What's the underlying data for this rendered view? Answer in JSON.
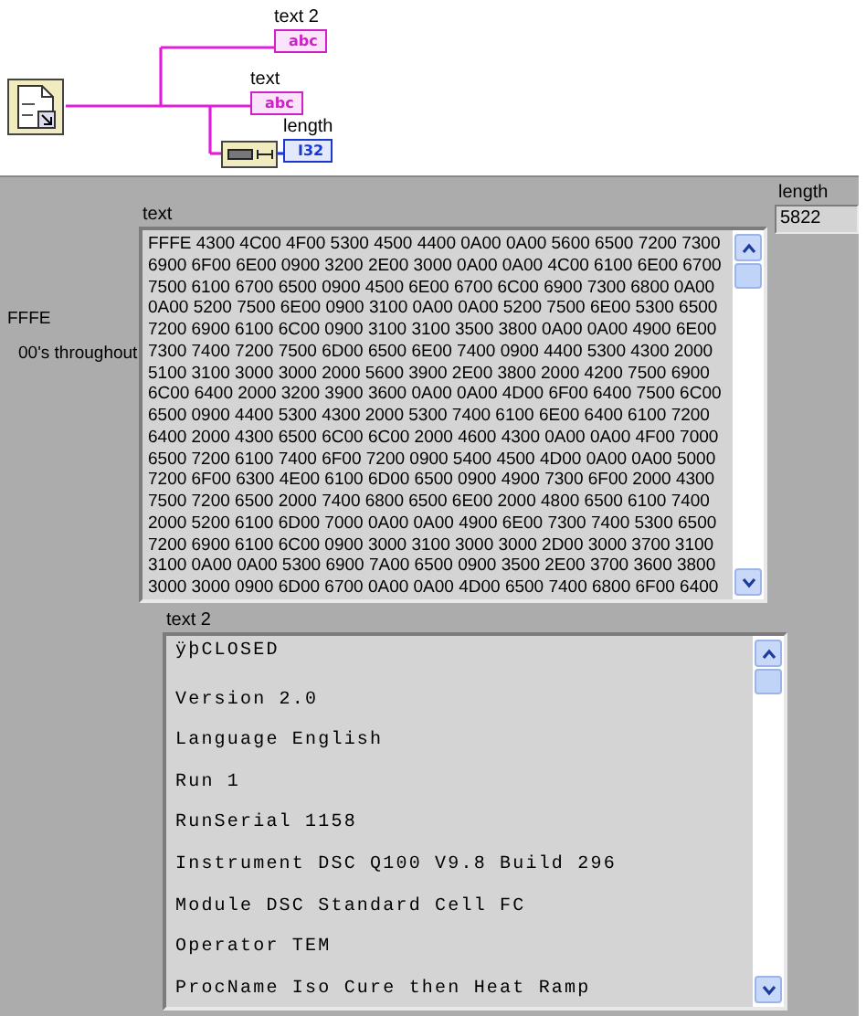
{
  "diagram": {
    "terminals": [
      {
        "label": "text 2",
        "type": "abc",
        "kind": "string"
      },
      {
        "label": "text",
        "type": "abc",
        "kind": "string"
      },
      {
        "label": "length",
        "type": "I32",
        "kind": "numeric"
      }
    ]
  },
  "panel": {
    "notes": [
      "FFFE",
      "00's throughout"
    ],
    "text": {
      "label": "text",
      "lines": [
        "FFFE 4300 4C00 4F00 5300 4500 4400 0A00 0A00 5600 6500 7200 7300",
        "6900 6F00 6E00 0900 3200 2E00 3000 0A00 0A00 4C00 6100 6E00 6700",
        "7500 6100 6700 6500 0900 4500 6E00 6700 6C00 6900 7300 6800 0A00",
        "0A00 5200 7500 6E00 0900 3100 0A00 0A00 5200 7500 6E00 5300 6500",
        "7200 6900 6100 6C00 0900 3100 3100 3500 3800 0A00 0A00 4900 6E00",
        "7300 7400 7200 7500 6D00 6500 6E00 7400 0900 4400 5300 4300 2000",
        "5100 3100 3000 3000 2000 5600 3900 2E00 3800 2000 4200 7500 6900",
        "6C00 6400 2000 3200 3900 3600 0A00 0A00 4D00 6F00 6400 7500 6C00",
        "6500 0900 4400 5300 4300 2000 5300 7400 6100 6E00 6400 6100 7200",
        "6400 2000 4300 6500 6C00 6C00 2000 4600 4300 0A00 0A00 4F00 7000",
        "6500 7200 6100 7400 6F00 7200 0900 5400 4500 4D00 0A00 0A00 5000",
        "7200 6F00 6300 4E00 6100 6D00 6500 0900 4900 7300 6F00 2000 4300",
        "7500 7200 6500 2000 7400 6800 6500 6E00 2000 4800 6500 6100 7400",
        "2000 5200 6100 6D00 7000 0A00 0A00 4900 6E00 7300 7400 5300 6500",
        "7200 6900 6100 6C00 0900 3000 3100 3000 3000 2D00 3000 3700 3100",
        "3100 0A00 0A00 5300 6900 7A00 6500 0900 3500 2E00 3700 3600 3800",
        "3000 3000 0900 6D00 6700 0A00 0A00 4D00 6500 7400 6800 6F00 6400"
      ]
    },
    "length": {
      "label": "length",
      "value": "5822"
    },
    "text2": {
      "label": "text 2",
      "lines": [
        "ÿþCLOSED",
        "Version 2.0",
        "Language English",
        "Run 1",
        "RunSerial 1158",
        "Instrument DSC Q100 V9.8 Build 296",
        "Module DSC Standard Cell FC",
        "Operator TEM",
        "ProcName Iso Cure then Heat Ramp"
      ]
    }
  }
}
